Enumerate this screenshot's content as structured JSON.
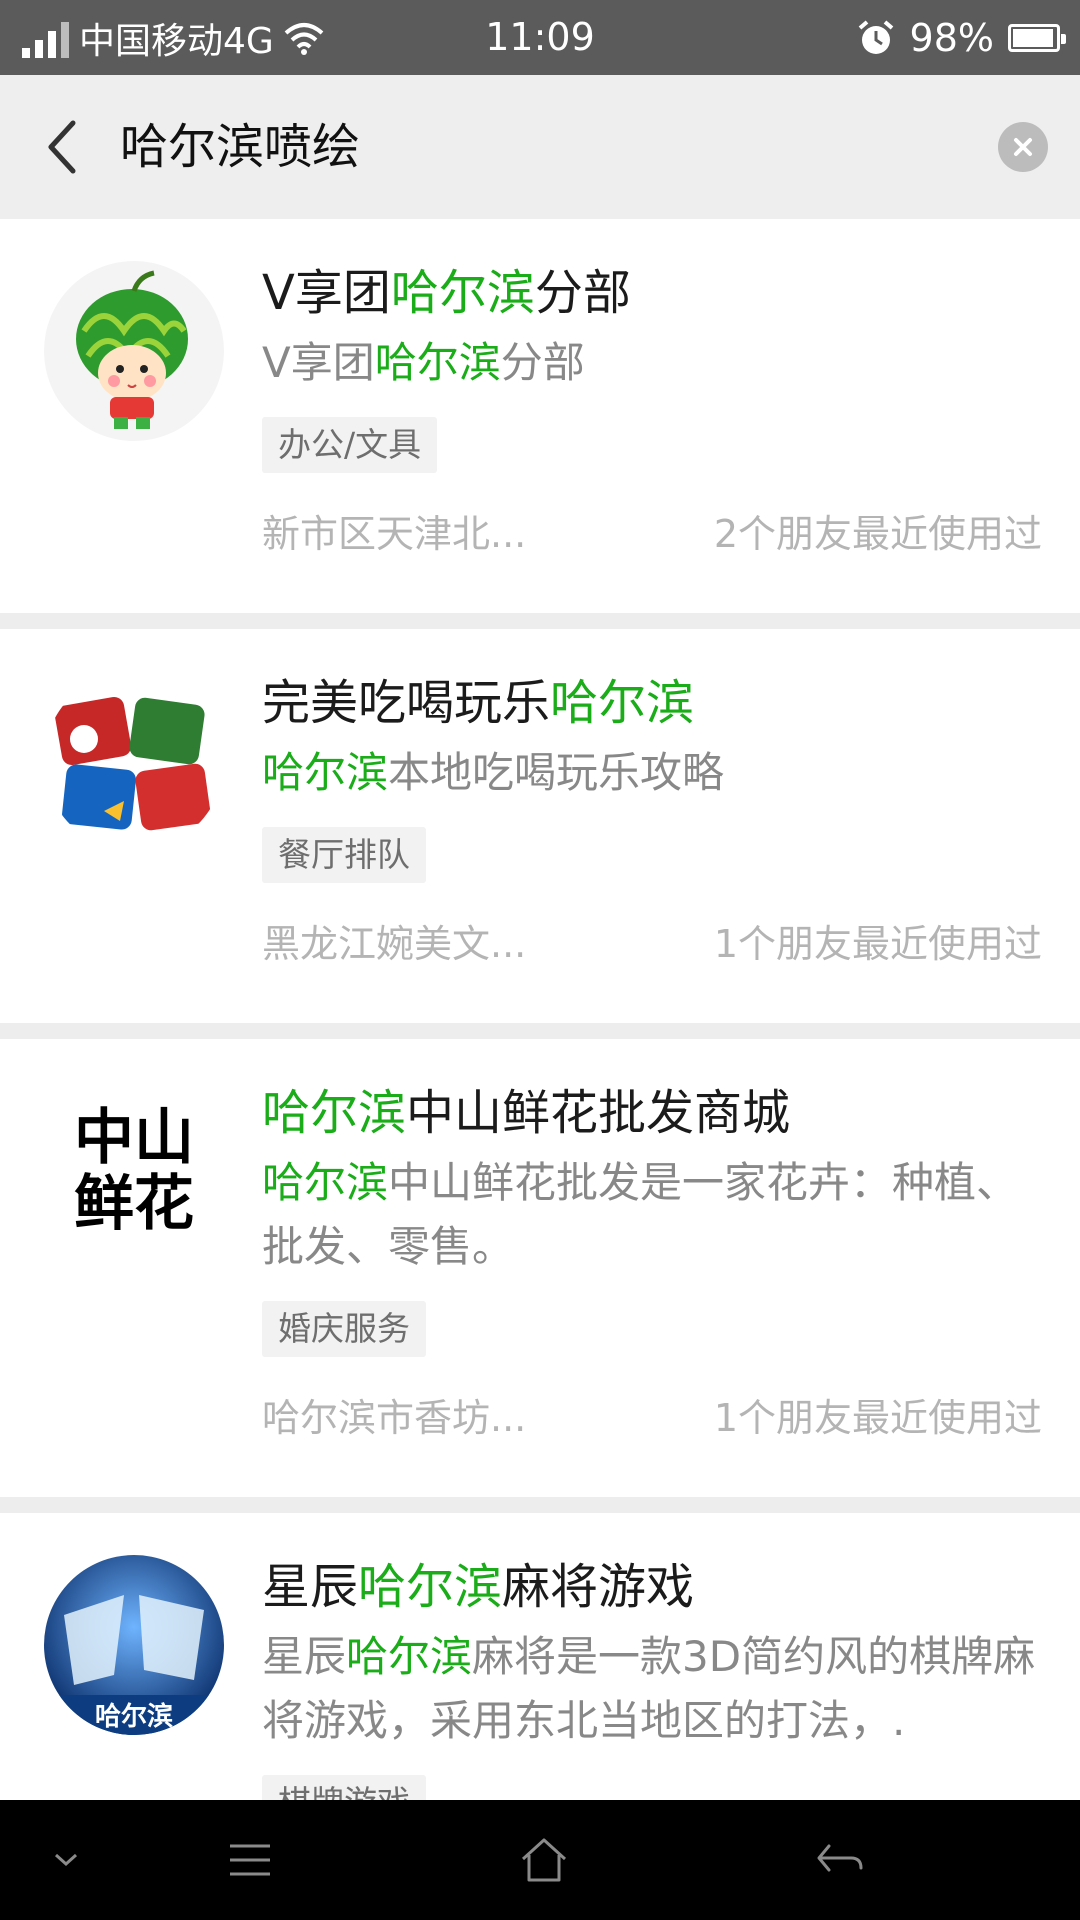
{
  "status_bar": {
    "carrier": "中国移动4G",
    "time": "11:09",
    "battery": "98%",
    "icons": [
      "signal-icon",
      "wifi-icon",
      "alarm-icon",
      "battery-icon"
    ]
  },
  "search": {
    "query": "哈尔滨喷绘"
  },
  "results": [
    {
      "title": [
        "V享团",
        "哈尔滨",
        "分部"
      ],
      "desc": [
        "V享团",
        "哈尔滨",
        "分部"
      ],
      "tag": "办公/文具",
      "location": "新市区天津北...",
      "friends": "2个朋友最近使用过"
    },
    {
      "title": [
        "完美吃喝玩乐",
        "哈尔滨",
        ""
      ],
      "desc": [
        "",
        "哈尔滨",
        "本地吃喝玩乐攻略"
      ],
      "tag": "餐厅排队",
      "location": "黑龙江婉美文...",
      "friends": "1个朋友最近使用过"
    },
    {
      "title": [
        "",
        "哈尔滨",
        "中山鲜花批发商城"
      ],
      "desc": [
        "",
        "哈尔滨",
        "中山鲜花批发是一家花卉：种植、批发、零售。"
      ],
      "tag": "婚庆服务",
      "location": "哈尔滨市香坊...",
      "friends": "1个朋友最近使用过",
      "avatar_text": [
        "中山",
        "鲜花"
      ]
    },
    {
      "title": [
        "星辰",
        "哈尔滨",
        "麻将游戏"
      ],
      "desc": [
        "星辰",
        "哈尔滨",
        "麻将是一款3D简约风的棋牌麻将游戏，采用东北当地区的打法，."
      ],
      "tag": "棋牌游戏",
      "avatar_text": "哈尔滨"
    }
  ],
  "colors": {
    "highlight": "#1aad19",
    "status_bar": "#5b5b5b",
    "header": "#eeeeee"
  }
}
